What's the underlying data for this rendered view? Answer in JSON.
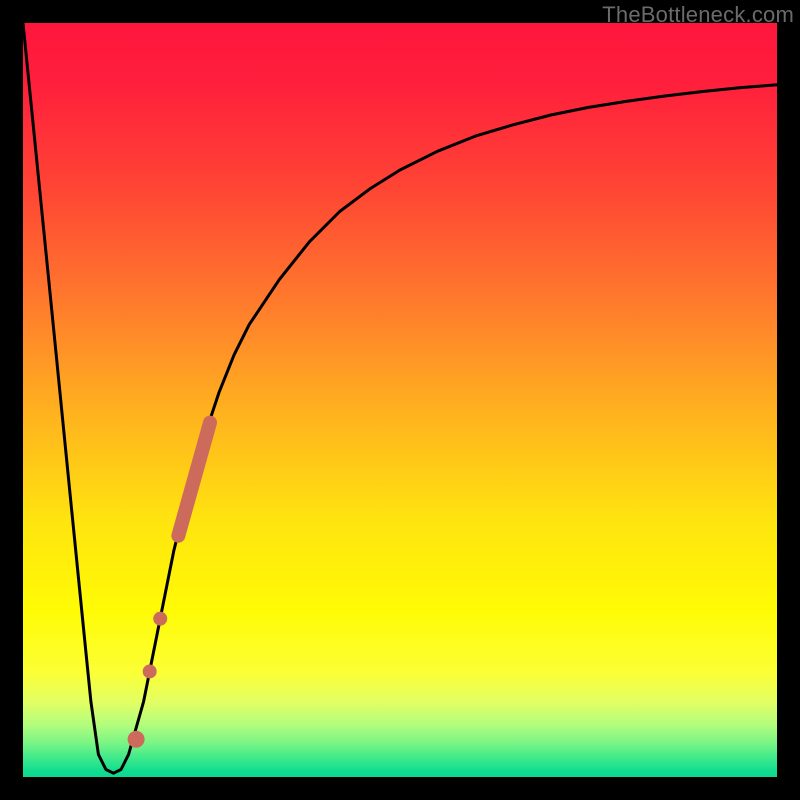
{
  "watermark": "TheBottleneck.com",
  "colors": {
    "frame": "#000000",
    "curve": "#000000",
    "marker": "#cc6a5c",
    "gradient_top": "#ff163d",
    "gradient_bottom": "#08d992"
  },
  "chart_data": {
    "type": "line",
    "title": "",
    "xlabel": "",
    "ylabel": "",
    "xlim": [
      0,
      100
    ],
    "ylim": [
      0,
      100
    ],
    "x": [
      0,
      2,
      4,
      6,
      8,
      9,
      10,
      11,
      12,
      13,
      14,
      16,
      18,
      20,
      22,
      24,
      26,
      28,
      30,
      34,
      38,
      42,
      46,
      50,
      55,
      60,
      65,
      70,
      75,
      80,
      85,
      90,
      95,
      100
    ],
    "y": [
      100,
      80,
      60,
      40,
      20,
      10,
      3,
      1,
      0.5,
      1,
      3,
      10,
      20,
      30,
      38,
      45,
      51,
      56,
      60,
      66,
      71,
      75,
      78,
      80.5,
      83,
      85,
      86.5,
      87.8,
      88.8,
      89.6,
      90.3,
      90.9,
      91.4,
      91.8
    ],
    "markers": {
      "segment": {
        "x_start": 20.6,
        "y_start": 32,
        "x_end": 24.8,
        "y_end": 47
      },
      "dots": [
        {
          "x": 18.2,
          "y": 21
        },
        {
          "x": 16.8,
          "y": 14
        },
        {
          "x": 15.0,
          "y": 5
        }
      ]
    },
    "annotations": [
      {
        "text": "TheBottleneck.com",
        "position": "top-right"
      }
    ]
  }
}
